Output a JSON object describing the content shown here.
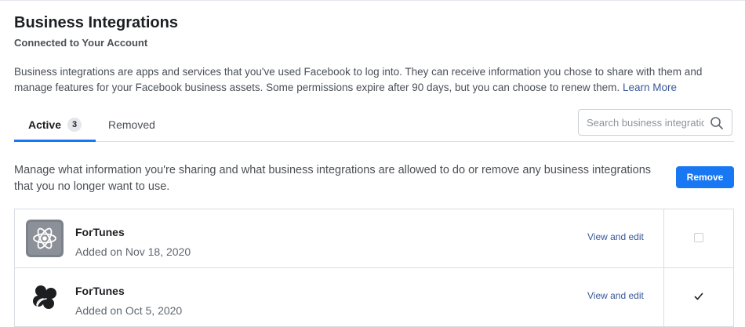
{
  "page": {
    "title": "Business Integrations",
    "subtitle": "Connected to Your Account",
    "description": "Business integrations are apps and services that you've used Facebook to log into. They can receive information you chose to share with them and manage features for your Facebook business assets. Some permissions expire after 90 days, but you can choose to renew them.",
    "learn_more": "Learn More"
  },
  "tabs": {
    "active_label": "Active",
    "active_count": "3",
    "removed_label": "Removed"
  },
  "search": {
    "placeholder": "Search business integrations",
    "icon": "search-icon"
  },
  "manage": {
    "text": "Manage what information you're sharing and what business integrations are allowed to do or remove any business integrations that you no longer want to use.",
    "remove_button": "Remove"
  },
  "integrations": [
    {
      "name": "ForTunes",
      "added": "Added on Nov 18, 2020",
      "action": "View and edit",
      "icon": "atom-icon",
      "checked": false
    },
    {
      "name": "ForTunes",
      "added": "Added on Oct 5, 2020",
      "action": "View and edit",
      "icon": "clover-icon",
      "checked": true
    }
  ],
  "colors": {
    "accent": "#1877f2",
    "link": "#385898",
    "text": "#1c1e21",
    "secondary_text": "#4b4f56",
    "border": "#dadde1"
  }
}
